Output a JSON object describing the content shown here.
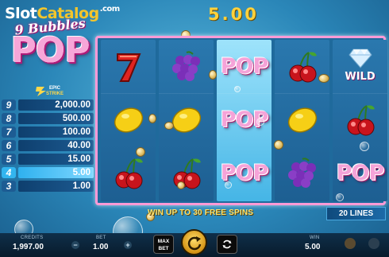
{
  "watermark": {
    "part1": "Slot",
    "part2": "Catalog",
    "part3": ".com"
  },
  "logo": {
    "subtitle": "9 Bubbles",
    "title": "POP",
    "badge_line1": "EPIC",
    "badge_line2": "STRIKE"
  },
  "paytable": [
    {
      "count": "9",
      "value": "2,000.00",
      "color": "#1d5c93"
    },
    {
      "count": "8",
      "value": "500.00",
      "color": "#1d5c93"
    },
    {
      "count": "7",
      "value": "100.00",
      "color": "#1d5c93"
    },
    {
      "count": "6",
      "value": "40.00",
      "color": "#1d5c93"
    },
    {
      "count": "5",
      "value": "15.00",
      "color": "#1d5c93"
    },
    {
      "count": "4",
      "value": "5.00",
      "color": "#33b5ef",
      "highlight": true
    },
    {
      "count": "3",
      "value": "1.00",
      "color": "#1d5c93"
    }
  ],
  "multiplier": "5.00",
  "reels": [
    [
      "seven-icon",
      "lemon-icon",
      "cherries-icon"
    ],
    [
      "grapes-icon",
      "lemon-icon",
      "cherries-icon"
    ],
    [
      "pop",
      "pop",
      "pop"
    ],
    [
      "cherries-icon",
      "lemon-icon",
      "grapes-icon"
    ],
    [
      "diamond-wild",
      "cherries-icon",
      "pop"
    ]
  ],
  "symbols": {
    "pop": "POP",
    "wild": "WILD"
  },
  "banner": "WIN UP TO 30 FREE SPINS",
  "lines": "20 LINES",
  "bottom": {
    "credits_label": "CREDITS",
    "credits_value": "1,997.00",
    "bet_label": "BET",
    "bet_value": "1.00",
    "minus": "−",
    "plus": "+",
    "maxbet_line1": "MAX",
    "maxbet_line2": "BET",
    "win_label": "WIN",
    "win_value": "5.00"
  },
  "colors": {
    "accent": "#ffd13b",
    "frame": "#ff9ad6",
    "pop": "#f5a3d8"
  }
}
